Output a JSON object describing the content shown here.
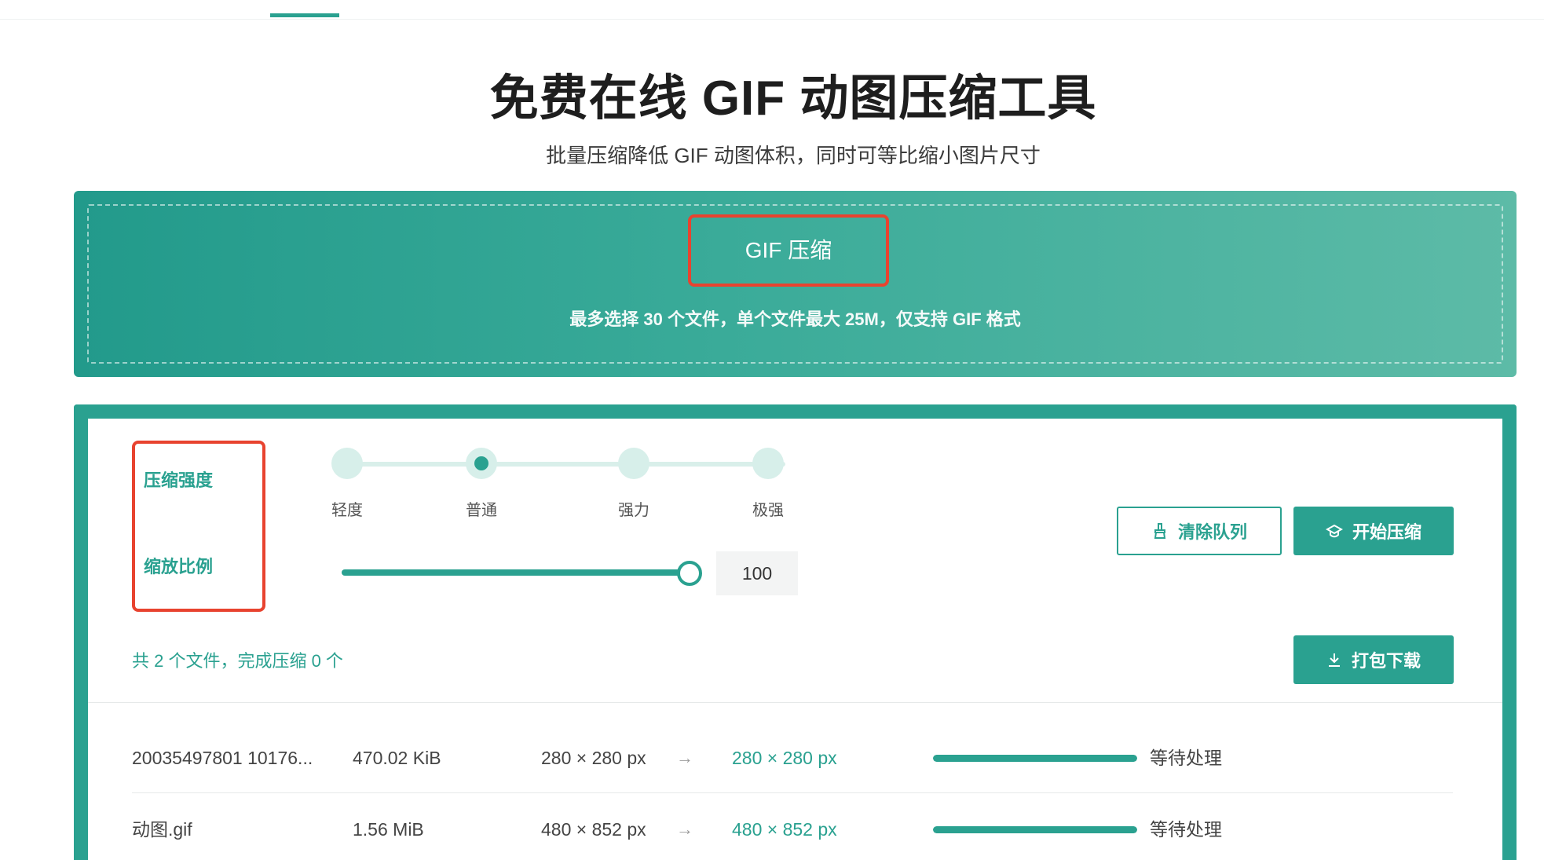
{
  "title": "免费在线 GIF 动图压缩工具",
  "subtitle": "批量压缩降低 GIF 动图体积，同时可等比缩小图片尺寸",
  "upload": {
    "button_label": "GIF 压缩",
    "hint": "最多选择 30 个文件，单个文件最大 25M，仅支持 GIF 格式"
  },
  "settings": {
    "intensity_label": "压缩强度",
    "scale_label": "缩放比例",
    "intensity_options": [
      "轻度",
      "普通",
      "强力",
      "极强"
    ],
    "intensity_selected": "普通",
    "scale_value": "100"
  },
  "buttons": {
    "clear_queue": "清除队列",
    "start_compress": "开始压缩",
    "download_all": "打包下载"
  },
  "summary": "共 2 个文件，完成压缩 0 个",
  "files": [
    {
      "name": "20035497801 10176...",
      "size": "470.02 KiB",
      "original_dims": "280 × 280 px",
      "new_dims": "280 × 280 px",
      "progress": 1.0,
      "status": "等待处理"
    },
    {
      "name": "动图.gif",
      "size": "1.56 MiB",
      "original_dims": "480 × 852 px",
      "new_dims": "480 × 852 px",
      "progress": 1.0,
      "status": "等待处理"
    }
  ],
  "icons": {
    "clear": "broom-icon",
    "start": "compress-icon",
    "download": "download-icon",
    "arrow": "arrow-right-icon"
  },
  "colors": {
    "accent": "#2aa190",
    "highlight_border": "#e8432f"
  }
}
